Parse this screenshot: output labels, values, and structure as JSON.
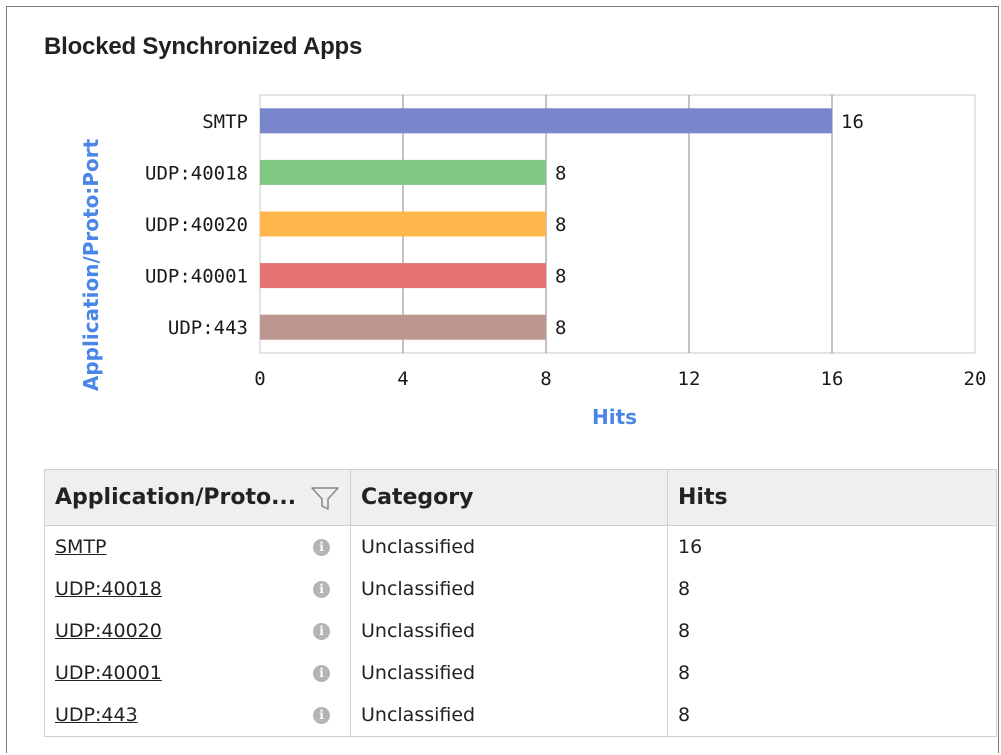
{
  "widget": {
    "title": "Blocked Synchronized Apps"
  },
  "chart_data": {
    "type": "bar",
    "orientation": "horizontal",
    "categories": [
      "SMTP",
      "UDP:40018",
      "UDP:40020",
      "UDP:40001",
      "UDP:443"
    ],
    "values": [
      16,
      8,
      8,
      8,
      8
    ],
    "colors": [
      "#7986cb",
      "#81c784",
      "#ffb74d",
      "#e57373",
      "#bc978f"
    ],
    "xlabel": "Hits",
    "ylabel": "Application/Proto:Port",
    "xlim": [
      0,
      20
    ],
    "xticks": [
      0,
      4,
      8,
      12,
      16,
      20
    ],
    "grid": true,
    "data_labels": true,
    "axis_label_color": "#4a86e8"
  },
  "table": {
    "headers": {
      "app": "Application/Proto...",
      "category": "Category",
      "hits": "Hits"
    },
    "rows": [
      {
        "app": "SMTP",
        "category": "Unclassified",
        "hits": "16"
      },
      {
        "app": "UDP:40018",
        "category": "Unclassified",
        "hits": "8"
      },
      {
        "app": "UDP:40020",
        "category": "Unclassified",
        "hits": "8"
      },
      {
        "app": "UDP:40001",
        "category": "Unclassified",
        "hits": "8"
      },
      {
        "app": "UDP:443",
        "category": "Unclassified",
        "hits": "8"
      }
    ],
    "info_icon_glyph": "i",
    "info_icon": "info-icon",
    "filter_icon": "filter-icon"
  }
}
